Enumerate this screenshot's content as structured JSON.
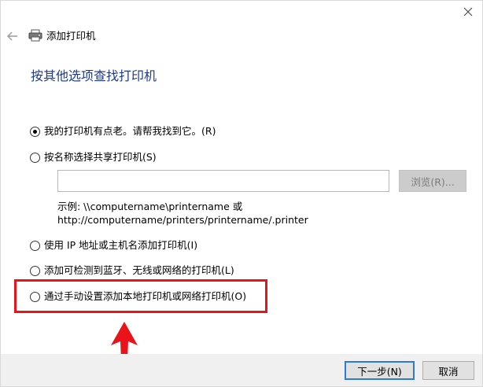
{
  "window": {
    "title": "添加打印机"
  },
  "page": {
    "heading": "按其他选项查找打印机"
  },
  "options": [
    {
      "label": "我的打印机有点老。请帮我找到它。(R)",
      "checked": true
    },
    {
      "label": "按名称选择共享打印机(S)",
      "checked": false
    },
    {
      "label": "使用 IP 地址或主机名添加打印机(I)",
      "checked": false
    },
    {
      "label": "添加可检测到蓝牙、无线或网络的打印机(L)",
      "checked": false
    },
    {
      "label": "通过手动设置添加本地打印机或网络打印机(O)",
      "checked": false
    }
  ],
  "shared_printer": {
    "input_value": "",
    "browse_label": "浏览(R)...",
    "example_line1": "示例: \\\\computername\\printername 或",
    "example_line2": "http://computername/printers/printername/.printer"
  },
  "footer": {
    "next_label": "下一步(N)",
    "cancel_label": "取消"
  },
  "colors": {
    "heading": "#1e3a8a",
    "highlight": "#e8141a",
    "primary_border": "#2f7ad8"
  },
  "icons": {
    "close": "close-icon",
    "back": "back-arrow-icon",
    "printer": "printer-icon",
    "annotation_arrow": "up-arrow-annotation"
  }
}
